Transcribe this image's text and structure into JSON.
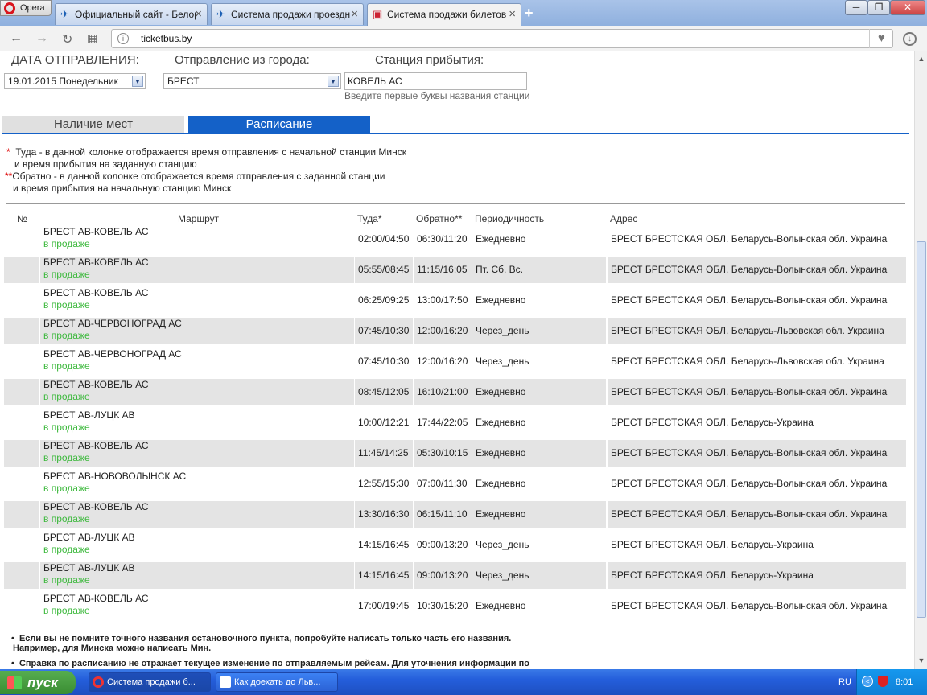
{
  "browser": {
    "menu_label": "Opera",
    "tabs": [
      {
        "label": "Официальный сайт - Белор",
        "icon": "bus-site-icon"
      },
      {
        "label": "Система продажи проездн",
        "icon": "bus-site-icon"
      },
      {
        "label": "Система продажи билетов",
        "icon": "ticket-icon",
        "active": true
      }
    ],
    "url": "ticketbus.by"
  },
  "form": {
    "date_label": "ДАТА ОТПРАВЛЕНИЯ:",
    "date_value": "19.01.2015 Понедельник",
    "from_label": "Отправление из города:",
    "from_value": "БРЕСТ",
    "to_label": "Станция прибытия:",
    "to_value": "КОВЕЛЬ АС",
    "to_hint": "Введите первые буквы названия станции"
  },
  "tabs": {
    "availability": "Наличие мест",
    "schedule": "Расписание"
  },
  "notes": {
    "n1_star": "*",
    "n1_line1": "Туда - в данной колонке отображается время отправления с начальной станции Минск",
    "n1_line2": "и время прибытия на заданную станцию",
    "n2_star": "**",
    "n2_line1": "Обратно - в данной колонке отображается время отправления с заданной станции",
    "n2_line2": "и время прибытия на начальную станцию Минск"
  },
  "table": {
    "headers": {
      "num": "№",
      "route": "Маршрут",
      "there": "Туда*",
      "back": "Обратно**",
      "period": "Периодичность",
      "address": "Адрес"
    },
    "rows": [
      {
        "route": "БРЕСТ АВ-КОВЕЛЬ АС",
        "status": "в продаже",
        "there": "02:00/04:50",
        "back": "06:30/11:20",
        "period": "Ежедневно",
        "address": "БРЕСТ БРЕСТСКАЯ ОБЛ. Беларусь-Волынская обл. Украина"
      },
      {
        "route": "БРЕСТ АВ-КОВЕЛЬ АС",
        "status": "в продаже",
        "there": "05:55/08:45",
        "back": "11:15/16:05",
        "period": "Пт. Сб. Вс.",
        "address": "БРЕСТ БРЕСТСКАЯ ОБЛ. Беларусь-Волынская обл. Украина"
      },
      {
        "route": "БРЕСТ АВ-КОВЕЛЬ АС",
        "status": "в продаже",
        "there": "06:25/09:25",
        "back": "13:00/17:50",
        "period": "Ежедневно",
        "address": "БРЕСТ БРЕСТСКАЯ ОБЛ. Беларусь-Волынская обл. Украина"
      },
      {
        "route": "БРЕСТ АВ-ЧЕРВОНОГРАД АС",
        "status": "в продаже",
        "there": "07:45/10:30",
        "back": "12:00/16:20",
        "period": "Через_день",
        "address": "БРЕСТ БРЕСТСКАЯ ОБЛ. Беларусь-Львовская обл. Украина"
      },
      {
        "route": "БРЕСТ АВ-ЧЕРВОНОГРАД АС",
        "status": "в продаже",
        "there": "07:45/10:30",
        "back": "12:00/16:20",
        "period": "Через_день",
        "address": "БРЕСТ БРЕСТСКАЯ ОБЛ. Беларусь-Львовская обл. Украина"
      },
      {
        "route": "БРЕСТ АВ-КОВЕЛЬ АС",
        "status": "в продаже",
        "there": "08:45/12:05",
        "back": "16:10/21:00",
        "period": "Ежедневно",
        "address": "БРЕСТ БРЕСТСКАЯ ОБЛ. Беларусь-Волынская обл. Украина"
      },
      {
        "route": "БРЕСТ АВ-ЛУЦК АВ",
        "status": "в продаже",
        "there": "10:00/12:21",
        "back": "17:44/22:05",
        "period": "Ежедневно",
        "address": "БРЕСТ БРЕСТСКАЯ ОБЛ. Беларусь-Украина"
      },
      {
        "route": "БРЕСТ АВ-КОВЕЛЬ АС",
        "status": "в продаже",
        "there": "11:45/14:25",
        "back": "05:30/10:15",
        "period": "Ежедневно",
        "address": "БРЕСТ БРЕСТСКАЯ ОБЛ. Беларусь-Волынская обл. Украина"
      },
      {
        "route": "БРЕСТ АВ-НОВОВОЛЫНСК АС",
        "status": "в продаже",
        "there": "12:55/15:30",
        "back": "07:00/11:30",
        "period": "Ежедневно",
        "address": "БРЕСТ БРЕСТСКАЯ ОБЛ. Беларусь-Волынская обл. Украина"
      },
      {
        "route": "БРЕСТ АВ-КОВЕЛЬ АС",
        "status": "в продаже",
        "there": "13:30/16:30",
        "back": "06:15/11:10",
        "period": "Ежедневно",
        "address": "БРЕСТ БРЕСТСКАЯ ОБЛ. Беларусь-Волынская обл. Украина"
      },
      {
        "route": "БРЕСТ АВ-ЛУЦК АВ",
        "status": "в продаже",
        "there": "14:15/16:45",
        "back": "09:00/13:20",
        "period": "Через_день",
        "address": "БРЕСТ БРЕСТСКАЯ ОБЛ. Беларусь-Украина"
      },
      {
        "route": "БРЕСТ АВ-ЛУЦК АВ",
        "status": "в продаже",
        "there": "14:15/16:45",
        "back": "09:00/13:20",
        "period": "Через_день",
        "address": "БРЕСТ БРЕСТСКАЯ ОБЛ. Беларусь-Украина"
      },
      {
        "route": "БРЕСТ АВ-КОВЕЛЬ АС",
        "status": "в продаже",
        "there": "17:00/19:45",
        "back": "10:30/15:20",
        "period": "Ежедневно",
        "address": "БРЕСТ БРЕСТСКАЯ ОБЛ. Беларусь-Волынская обл. Украина"
      }
    ]
  },
  "footer": {
    "tip1_line1": "Если вы не помните точного названия остановочного пункта, попробуйте написать только часть его названия.",
    "tip1_line2": "Например, для Минска можно написать Мин.",
    "tip2_line1": "Справка по расписанию не отражает текущее изменение по отправляемым рейсам. Для уточнения информации по"
  },
  "taskbar": {
    "start_label": "пуск",
    "buttons": [
      {
        "label": "Система продажи б...",
        "icon": "opera-icon",
        "active": true
      },
      {
        "label": "Как доехать до Льв...",
        "icon": "word-icon",
        "active": false
      }
    ],
    "lang": "RU",
    "clock": "8:01"
  },
  "colors": {
    "accent": "#1461c8",
    "status_green": "#3db93d",
    "row_alt": "#e4e4e4"
  }
}
